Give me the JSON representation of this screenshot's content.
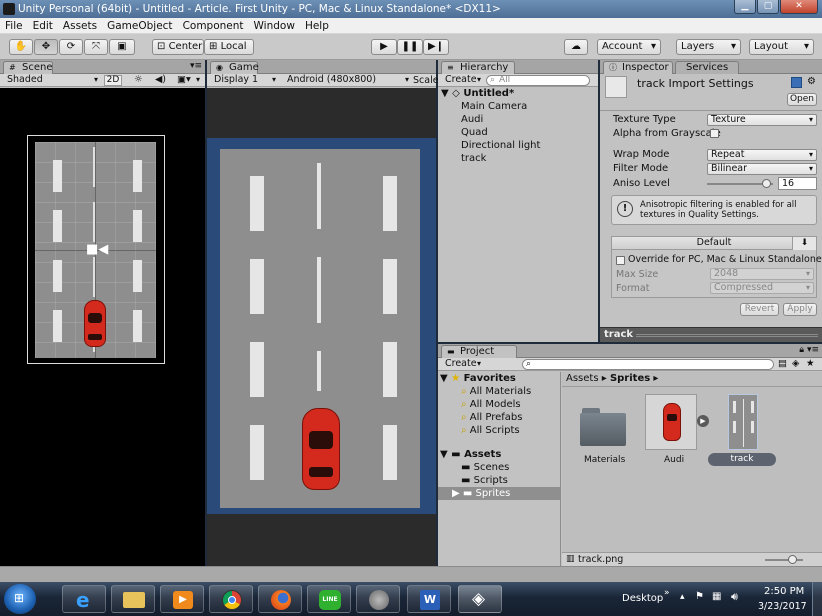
{
  "window": {
    "title": "Unity Personal (64bit) - Untitled - Article. First Unity - PC, Mac & Linux Standalone* <DX11>"
  },
  "menu": [
    "File",
    "Edit",
    "Assets",
    "GameObject",
    "Component",
    "Window",
    "Help"
  ],
  "toolbar": {
    "center": "Center",
    "local": "Local",
    "account": "Account",
    "layers": "Layers",
    "layout": "Layout"
  },
  "scene": {
    "tab": "Scene",
    "shading": "Shaded",
    "mode_2d": "2D"
  },
  "game": {
    "tab": "Game",
    "display": "Display 1",
    "resolution": "Android (480x800)",
    "scale": "Scale"
  },
  "hierarchy": {
    "tab": "Hierarchy",
    "create": "Create",
    "search_placeholder": "All",
    "scene_name": "Untitled*",
    "items": [
      "Main Camera",
      "Audi",
      "Quad",
      "Directional light",
      "track"
    ]
  },
  "inspector": {
    "tab": "Inspector",
    "tab2": "Services",
    "title": "track Import Settings",
    "open": "Open",
    "texture_type_label": "Texture Type",
    "texture_type": "Texture",
    "alpha_label": "Alpha from Grayscale",
    "wrap_label": "Wrap Mode",
    "wrap": "Repeat",
    "filter_label": "Filter Mode",
    "filter": "Bilinear",
    "aniso_label": "Aniso Level",
    "aniso": "16",
    "aniso_level": 0.9,
    "warning": "Anisotropic filtering is enabled for all textures in Quality Settings.",
    "platform_header": "Default",
    "override_label": "Override for PC, Mac & Linux Standalone",
    "max_size_label": "Max Size",
    "max_size": "2048",
    "format_label": "Format",
    "format": "Compressed",
    "revert": "Revert",
    "apply": "Apply",
    "preview_label": "track"
  },
  "project": {
    "tab": "Project",
    "create": "Create",
    "favorites": "Favorites",
    "fav_items": [
      "All Materials",
      "All Models",
      "All Prefabs",
      "All Scripts"
    ],
    "assets": "Assets",
    "asset_folders": [
      "Scenes",
      "Scripts",
      "Sprites"
    ],
    "breadcrumb": [
      "Assets",
      "Sprites"
    ],
    "grid_items": [
      "Materials",
      "Audi",
      "track"
    ],
    "selected_file": "track.png"
  },
  "taskbar": {
    "desktop": "Desktop",
    "time": "2:50 PM",
    "date": "3/23/2017"
  },
  "colors": {
    "track_bg": "#8e8e8e",
    "track_dark": "#5d5d5d",
    "car_red": "#d42a1d",
    "game_border": "#2a4a7a"
  }
}
